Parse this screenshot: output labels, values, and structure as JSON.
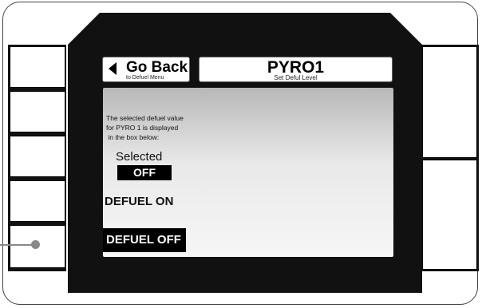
{
  "header": {
    "back_label": "Go Back",
    "back_sublabel": "to Defuel Menu",
    "title": "PYRO1",
    "subtitle": "Set Deful Level"
  },
  "main": {
    "description": "The selected defuel value\nfor PYRO 1 is displayed\n in the box below:",
    "selected_label": "Selected",
    "selected_value": "OFF",
    "options": [
      {
        "label": "DEFUEL ON",
        "highlighted": false
      },
      {
        "label": "DEFUEL OFF",
        "highlighted": true
      }
    ]
  },
  "colors": {
    "bezel_black": "#111111",
    "highlight": "#000000",
    "pointer": "#888888"
  },
  "icons": {
    "back": "left-triangle-arrow"
  }
}
